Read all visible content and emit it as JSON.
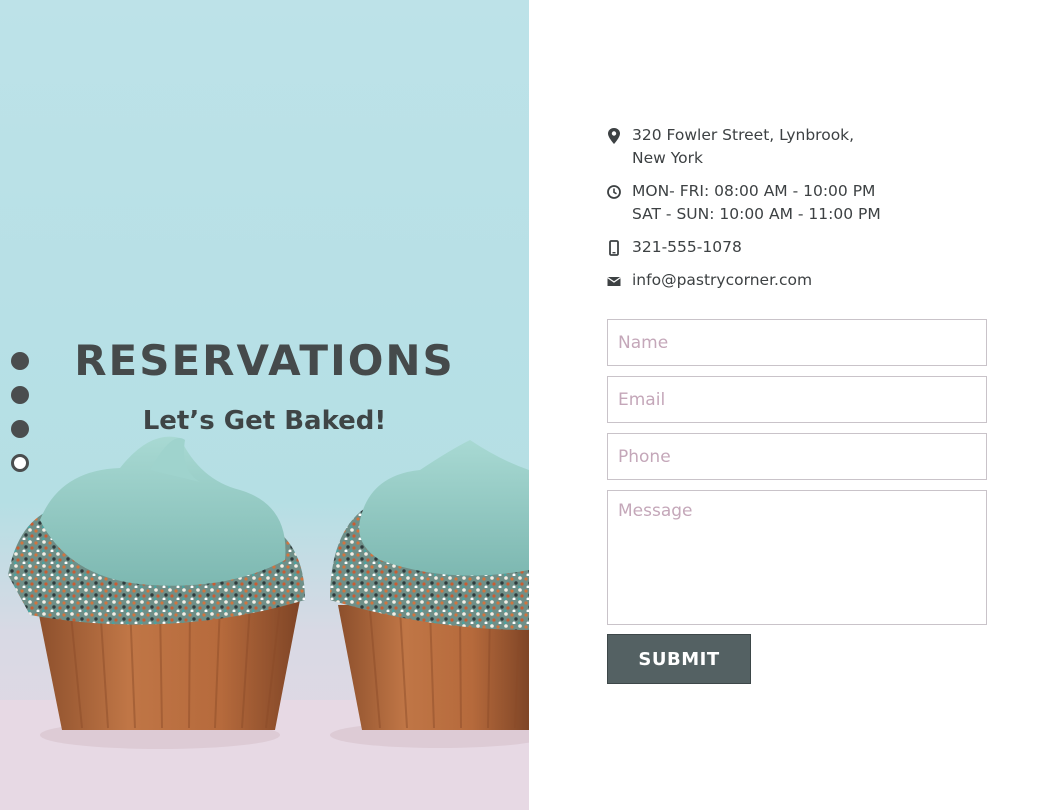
{
  "hero": {
    "title": "RESERVATIONS",
    "subtitle": "Let’s Get Baked!",
    "image_alt_icon": "cupcakes-photo",
    "slide_dots": [
      {
        "active": false
      },
      {
        "active": false
      },
      {
        "active": false
      },
      {
        "active": true
      }
    ]
  },
  "contact_info": {
    "address_line1": "320 Fowler Street, Lynbrook,",
    "address_line2": "New York",
    "hours_line1": "MON- FRI: 08:00 AM - 10:00 PM",
    "hours_line2": "SAT - SUN: 10:00 AM - 11:00 PM",
    "phone": "321-555-1078",
    "email": "info@pastrycorner.com",
    "icons": [
      "map-pin-icon",
      "clock-icon",
      "phone-icon",
      "envelope-icon"
    ]
  },
  "form": {
    "name_placeholder": "Name",
    "email_placeholder": "Email",
    "phone_placeholder": "Phone",
    "message_placeholder": "Message",
    "submit_label": "SUBMIT"
  },
  "colors": {
    "hero_sky": "#b7e0e6",
    "frosting": "#86bfb8",
    "cupcake_wrapper": "#b5683a",
    "heading_text": "#454a4b",
    "button_bg": "#546163",
    "placeholder": "#c4a7b9"
  }
}
